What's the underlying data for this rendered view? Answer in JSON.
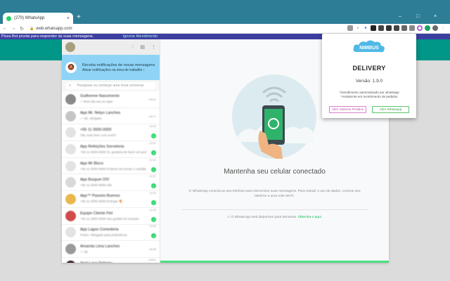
{
  "browser": {
    "tab_title": "(270) WhatsApp",
    "tab_close": "×",
    "new_tab": "+",
    "url": "web.whatsapp.com",
    "window_controls": [
      "–",
      "□",
      "×"
    ]
  },
  "infobar": {
    "text": "Pizza Bot pronta para responder às suas mensagens.",
    "link": "Ignorar Atendimento"
  },
  "sidebar": {
    "notification_title": "Receba notificações de novas mensagens",
    "notification_subtitle": "Ativar notificações na área de trabalho ›",
    "search_placeholder": "Pesquisar ou começar uma nova conversa",
    "chats": [
      {
        "name": "Guilherme Nascimento",
        "msg": "✓ Bom dia sou eu aqui",
        "time": "09:51",
        "badge": "",
        "color": "#8a8a8a"
      },
      {
        "name": "App Mr. Netyo Lanches",
        "msg": "✓ Ok, obrigado",
        "time": "09:17",
        "badge": "",
        "color": "#c5c5c5"
      },
      {
        "name": "+55 11 0000-0000",
        "msg": "Olá, tudo bem com você?",
        "time": "13:03",
        "badge": "6",
        "color": "#e3e3e3"
      },
      {
        "name": "App Refeições Sorveteria",
        "msg": "+55 11 0000-0000 Oi, gostaria de fazer um pedido",
        "time": "13:02",
        "badge": "3",
        "color": "#e3e3e3"
      },
      {
        "name": "App Mr Bloco",
        "msg": "+55 11 0000-0000 Poderia me enviar o cardápio",
        "time": "12:23",
        "badge": "3",
        "color": "#e3e3e3"
      },
      {
        "name": "App Burguer DIV",
        "msg": "+55 11 0000-0000 Olá",
        "time": "12:27",
        "badge": "5",
        "color": "#d9d9d9"
      },
      {
        "name": "App™ Passeio Buenos",
        "msg": "+55 11 0000-0000 Entrega 🍕",
        "time": "11:52",
        "badge": "3",
        "color": "#e8b84a"
      },
      {
        "name": "Equipe Cliente Fiel",
        "msg": "+55 11 0000-0000 Seu pedido foi enviado",
        "time": "11:26",
        "badge": "4",
        "color": "#d14b4b"
      },
      {
        "name": "App Lagos Comedoria",
        "msg": "Pedro: Obrigado pela preferência",
        "time": "10:06",
        "badge": "3",
        "color": "#e3e3e3"
      },
      {
        "name": "Amanda Lima Lanches",
        "msg": "✓ Ok",
        "time": "09:48",
        "badge": "",
        "color": "#9a9a9a"
      },
      {
        "name": "Appl Lava Delivery",
        "msg": "+55 11 0000-0000",
        "time": "ontem",
        "badge": "3",
        "color": "#3a1a2a"
      },
      {
        "name": "App Minha Pizza",
        "msg": "Olá",
        "time": "ontem",
        "badge": "",
        "color": "#e3e3e3"
      }
    ]
  },
  "main": {
    "headline": "Mantenha seu celular conectado",
    "desc": "O WhatsApp conecta ao seu telefone para sincronizar suas mensagens. Para reduzir o uso de dados, conecte seu telefone a uma rede Wi-Fi.",
    "windows_note": "O WhatsApp está disponível para Windows.",
    "windows_link": "Obtenha-o aqui."
  },
  "popup": {
    "logo_text": "NIMBUS",
    "title": "DELIVERY",
    "version": "Versão: 1.9.0",
    "feature1": "*Atendimento automatizado por whatsapp",
    "feature2": "*Assistente em recebimento de pedidos",
    "btn_pedidos": "Abrir Sistema Pedidos",
    "btn_whatsapp": "Abrir Whatsapp"
  },
  "colors": {
    "tabbar": "#2d7d96",
    "whatsapp_teal": "#009688",
    "whatsapp_green": "#25d366",
    "notif_blue": "#8fd4f6",
    "infobar": "#3c3fa0"
  }
}
